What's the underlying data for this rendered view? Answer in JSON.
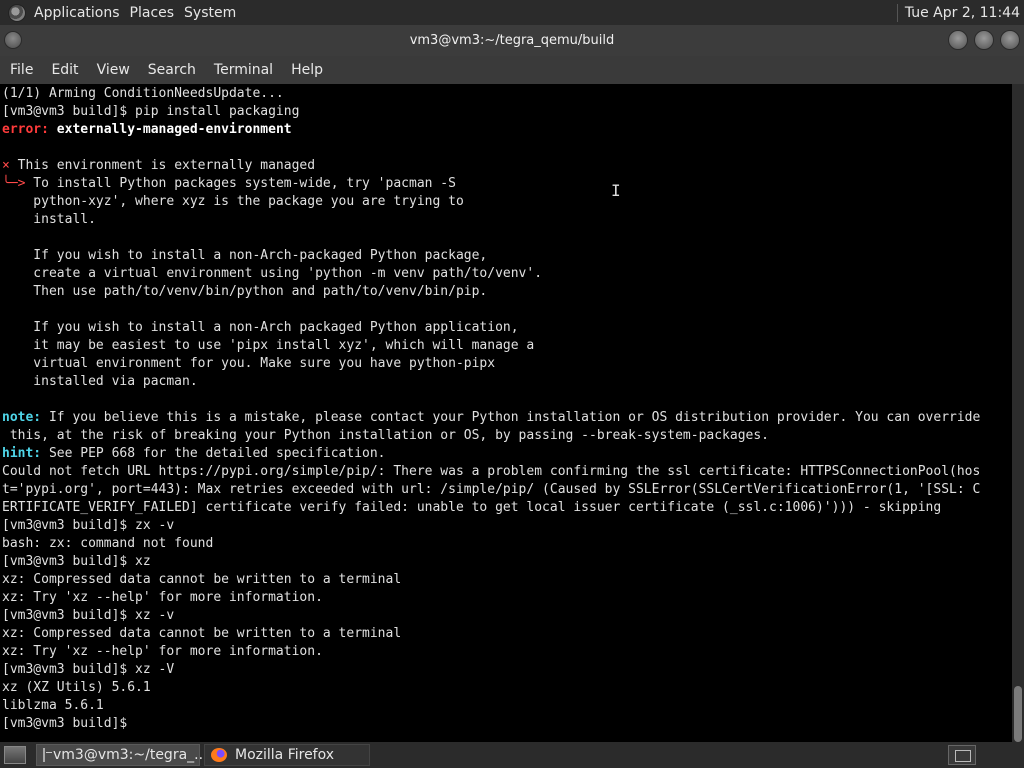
{
  "top_panel": {
    "menus": [
      "Applications",
      "Places",
      "System"
    ],
    "clock": "Tue Apr  2, 11:44"
  },
  "window": {
    "title": "vm3@vm3:~/tegra_qemu/build"
  },
  "menubar": [
    "File",
    "Edit",
    "View",
    "Search",
    "Terminal",
    "Help"
  ],
  "terminal": {
    "lines": [
      "(1/1) Arming ConditionNeedsUpdate...",
      "[vm3@vm3 build]$ pip install packaging",
      {
        "label": "error:",
        "text": " externally-managed-environment"
      },
      "",
      {
        "mark": "×",
        "text": " This environment is externally managed"
      },
      {
        "mark": "╰─>",
        "text": " To install Python packages system-wide, try 'pacman -S"
      },
      "    python-xyz', where xyz is the package you are trying to",
      "    install.",
      "",
      "    If you wish to install a non-Arch-packaged Python package,",
      "    create a virtual environment using 'python -m venv path/to/venv'.",
      "    Then use path/to/venv/bin/python and path/to/venv/bin/pip.",
      "",
      "    If you wish to install a non-Arch packaged Python application,",
      "    it may be easiest to use 'pipx install xyz', which will manage a",
      "    virtual environment for you. Make sure you have python-pipx",
      "    installed via pacman.",
      "",
      {
        "label": "note:",
        "text": " If you believe this is a mistake, please contact your Python installation or OS distribution provider. You can override"
      },
      " this, at the risk of breaking your Python installation or OS, by passing --break-system-packages.",
      {
        "label": "hint:",
        "text": " See PEP 668 for the detailed specification."
      },
      "Could not fetch URL https://pypi.org/simple/pip/: There was a problem confirming the ssl certificate: HTTPSConnectionPool(hos",
      "t='pypi.org', port=443): Max retries exceeded with url: /simple/pip/ (Caused by SSLError(SSLCertVerificationError(1, '[SSL: C",
      "ERTIFICATE_VERIFY_FAILED] certificate verify failed: unable to get local issuer certificate (_ssl.c:1006)'))) - skipping",
      "[vm3@vm3 build]$ zx -v",
      "bash: zx: command not found",
      "[vm3@vm3 build]$ xz",
      "xz: Compressed data cannot be written to a terminal",
      "xz: Try 'xz --help' for more information.",
      "[vm3@vm3 build]$ xz -v",
      "xz: Compressed data cannot be written to a terminal",
      "xz: Try 'xz --help' for more information.",
      "[vm3@vm3 build]$ xz -V",
      "xz (XZ Utils) 5.6.1",
      "liblzma 5.6.1",
      "[vm3@vm3 build]$ "
    ]
  },
  "taskbar": {
    "tasks": [
      {
        "label": "vm3@vm3:~/tegra_...",
        "icon": "terminal-icon",
        "active": true
      },
      {
        "label": "Mozilla Firefox",
        "icon": "firefox-icon",
        "active": false
      }
    ]
  },
  "colors": {
    "error": "#ff3b3b",
    "note_hint": "#4fd5e8",
    "panel": "#2b2b2b",
    "titlebar": "#3c3c3c"
  }
}
